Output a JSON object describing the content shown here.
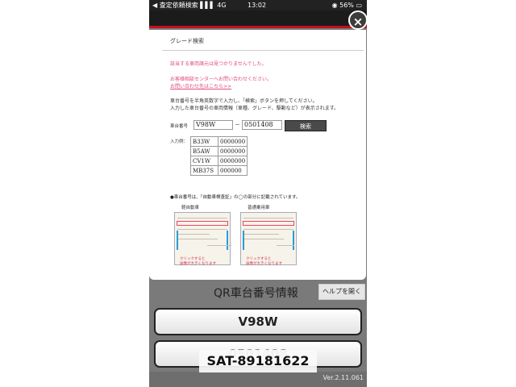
{
  "status_bar": {
    "left_text": "◀ 査定依頼検索 ▌▌▌ 4G",
    "time": "13:02",
    "battery": "◉ 56% ▭"
  },
  "modal": {
    "title": "グレード検索",
    "error_lines": [
      "該当する車両諸元は見つかりませんでした。",
      "お客様相談センターへお問い合わせください。",
      "お問い合わせ先はこちら>>"
    ],
    "description_lines": [
      "車台番号を半角英数字で入力し、「検索」ボタンを押してください。",
      "入力した車台番号の車両情報（車種、グレード、駆動など）が表示されます。"
    ],
    "chassis_label": "車台番号",
    "chassis_prefix_value": "V98W",
    "chassis_number_value": "0501408",
    "dash": "－",
    "search_button": "検索",
    "example_label": "入力例：",
    "examples": [
      {
        "prefix": "B33W",
        "number": "0000000"
      },
      {
        "prefix": "B5AW",
        "number": "0000000"
      },
      {
        "prefix": "CV1W",
        "number": "0000000"
      },
      {
        "prefix": "MB37S",
        "number": "000000"
      }
    ],
    "note": "●車台番号は、「自動車検査証」の◯の部分に記載されています。",
    "figures": [
      {
        "title": "軽自動車",
        "caption": [
          "クリックすると",
          "画像が大きくなります"
        ]
      },
      {
        "title": "普通乗用車",
        "caption": [
          "クリックすると",
          "画像が大きくなります"
        ]
      }
    ]
  },
  "close_icon": "×",
  "qr_title": "QR車台番号情報",
  "help_button": "ヘルプを開く",
  "prefix_button": "V98W",
  "number_button": "0501408",
  "version": "Ver.2.11.061",
  "watermark": "SAT-89181622"
}
